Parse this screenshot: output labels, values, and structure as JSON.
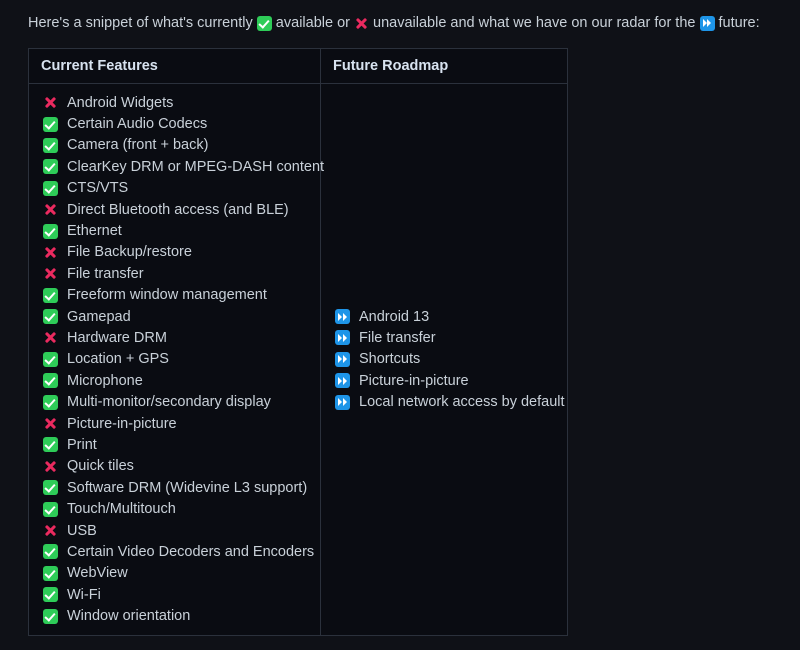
{
  "intro": {
    "part1": "Here's a snippet of what's currently ",
    "icon_available": "white-check-mark-icon",
    "part2": " available or ",
    "icon_unavailable": "cross-mark-icon",
    "part3": " unavailable and what we have on our radar for the ",
    "icon_future": "fast-forward-icon",
    "part4": " future:"
  },
  "table": {
    "headers": {
      "current": "Current Features",
      "roadmap": "Future Roadmap"
    },
    "current_features": [
      {
        "status": "unavailable",
        "label": "Android Widgets"
      },
      {
        "status": "available",
        "label": "Certain Audio Codecs"
      },
      {
        "status": "available",
        "label": "Camera (front + back)"
      },
      {
        "status": "available",
        "label": "ClearKey DRM or MPEG-DASH content"
      },
      {
        "status": "available",
        "label": "CTS/VTS"
      },
      {
        "status": "unavailable",
        "label": "Direct Bluetooth access (and BLE)"
      },
      {
        "status": "available",
        "label": "Ethernet"
      },
      {
        "status": "unavailable",
        "label": "File Backup/restore"
      },
      {
        "status": "unavailable",
        "label": "File transfer"
      },
      {
        "status": "available",
        "label": "Freeform window management"
      },
      {
        "status": "available",
        "label": "Gamepad"
      },
      {
        "status": "unavailable",
        "label": "Hardware DRM"
      },
      {
        "status": "available",
        "label": "Location + GPS"
      },
      {
        "status": "available",
        "label": "Microphone"
      },
      {
        "status": "available",
        "label": "Multi-monitor/secondary display"
      },
      {
        "status": "unavailable",
        "label": "Picture-in-picture"
      },
      {
        "status": "available",
        "label": "Print"
      },
      {
        "status": "unavailable",
        "label": "Quick tiles"
      },
      {
        "status": "available",
        "label": "Software DRM (Widevine L3 support)"
      },
      {
        "status": "available",
        "label": "Touch/Multitouch"
      },
      {
        "status": "unavailable",
        "label": "USB"
      },
      {
        "status": "available",
        "label": "Certain Video Decoders and Encoders"
      },
      {
        "status": "available",
        "label": "WebView"
      },
      {
        "status": "available",
        "label": "Wi-Fi"
      },
      {
        "status": "available",
        "label": "Window orientation"
      }
    ],
    "future_roadmap": [
      {
        "status": "future",
        "label": "Android 13"
      },
      {
        "status": "future",
        "label": "File transfer"
      },
      {
        "status": "future",
        "label": "Shortcuts"
      },
      {
        "status": "future",
        "label": "Picture-in-picture"
      },
      {
        "status": "future",
        "label": "Local network access by default"
      }
    ]
  },
  "colors": {
    "page_background": "#0f1117",
    "table_background": "#0a0c12",
    "border": "#2b313c",
    "text": "#c9d1d9",
    "header_text": "#d8e3f0",
    "available_green": "#2ecc58",
    "unavailable_red": "#ea2a5f",
    "future_blue": "#1e95e8"
  }
}
